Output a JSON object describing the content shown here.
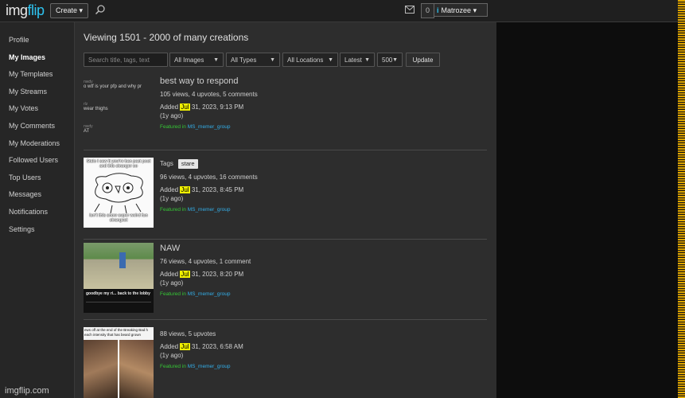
{
  "topbar": {
    "logo_plain": "img",
    "logo_accent": "flip",
    "create_label": "Create",
    "notif_count": "0",
    "username": "Matrozee",
    "user_badge": "i"
  },
  "sidebar": {
    "items": [
      {
        "label": "Profile"
      },
      {
        "label": "My Images"
      },
      {
        "label": "My Templates"
      },
      {
        "label": "My Streams"
      },
      {
        "label": "My Votes"
      },
      {
        "label": "My Comments"
      },
      {
        "label": "My Moderations"
      },
      {
        "label": "Followed Users"
      },
      {
        "label": "Top Users"
      },
      {
        "label": "Messages"
      },
      {
        "label": "Notifications"
      },
      {
        "label": "Settings"
      }
    ],
    "active": "My Images",
    "footer": "imgflip.com"
  },
  "main": {
    "heading": "Viewing 1501 - 2000 of many creations",
    "filters": {
      "search_placeholder": "Search title, tags, text",
      "images": "All Images",
      "types": "All Types",
      "locations": "All Locations",
      "sort": "Latest",
      "count": "500",
      "update": "Update"
    },
    "posts": [
      {
        "title": "best way to respond",
        "stats": "105 views, 4 upvotes, 5 comments",
        "added_prefix": "Added ",
        "month": "Jul",
        "added_rest": " 31, 2023, 9:13 PM",
        "ago": "(1y ago)",
        "featured_in": "Featured in ",
        "stream": "MS_memer_group",
        "comments": [
          {
            "user": "nwdy",
            "text": "o wtf is your pfp and why pr"
          },
          {
            "user": "rlz",
            "text": "wear thighs"
          },
          {
            "user": "nwdy",
            "text": "AT"
          }
        ]
      },
      {
        "tags_label": "Tags",
        "tag": "stare",
        "stats": "96 views, 4 upvotes, 16 comments",
        "added_prefix": "Added ",
        "month": "Jul",
        "added_rest": " 31, 2023, 8:45 PM",
        "ago": "(1y ago)",
        "featured_in": "Featured in ",
        "stream": "MS_memer_group",
        "caption_top": "Stalo I saw it you’re ban past post and this stranger so",
        "caption_bottom": "isn’t this snow super weird fun strangest"
      },
      {
        "title": "NAW",
        "stats": "76 views, 4 upvotes, 1 comment",
        "added_prefix": "Added ",
        "month": "Jul",
        "added_rest": " 31, 2023, 8:20 PM",
        "ago": "(1y ago)",
        "featured_in": "Featured in ",
        "stream": "MS_memer_group",
        "caption": "goodbye my ri... back to the lobby"
      },
      {
        "stats": "88 views, 5 upvotes",
        "added_prefix": "Added ",
        "month": "Jul",
        "added_rest": " 31, 2023, 6:58 AM",
        "ago": "(1y ago)",
        "featured_in": "Featured in ",
        "stream": "MS_memer_group",
        "caption": "ews off at the end of the Breaking Bad h each intensity that has beard grown"
      }
    ]
  },
  "colors": {
    "accent": "#2ec3f0",
    "highlight": "#f0f000",
    "featured_green": "#35c735",
    "featured_link": "#33aee8"
  }
}
